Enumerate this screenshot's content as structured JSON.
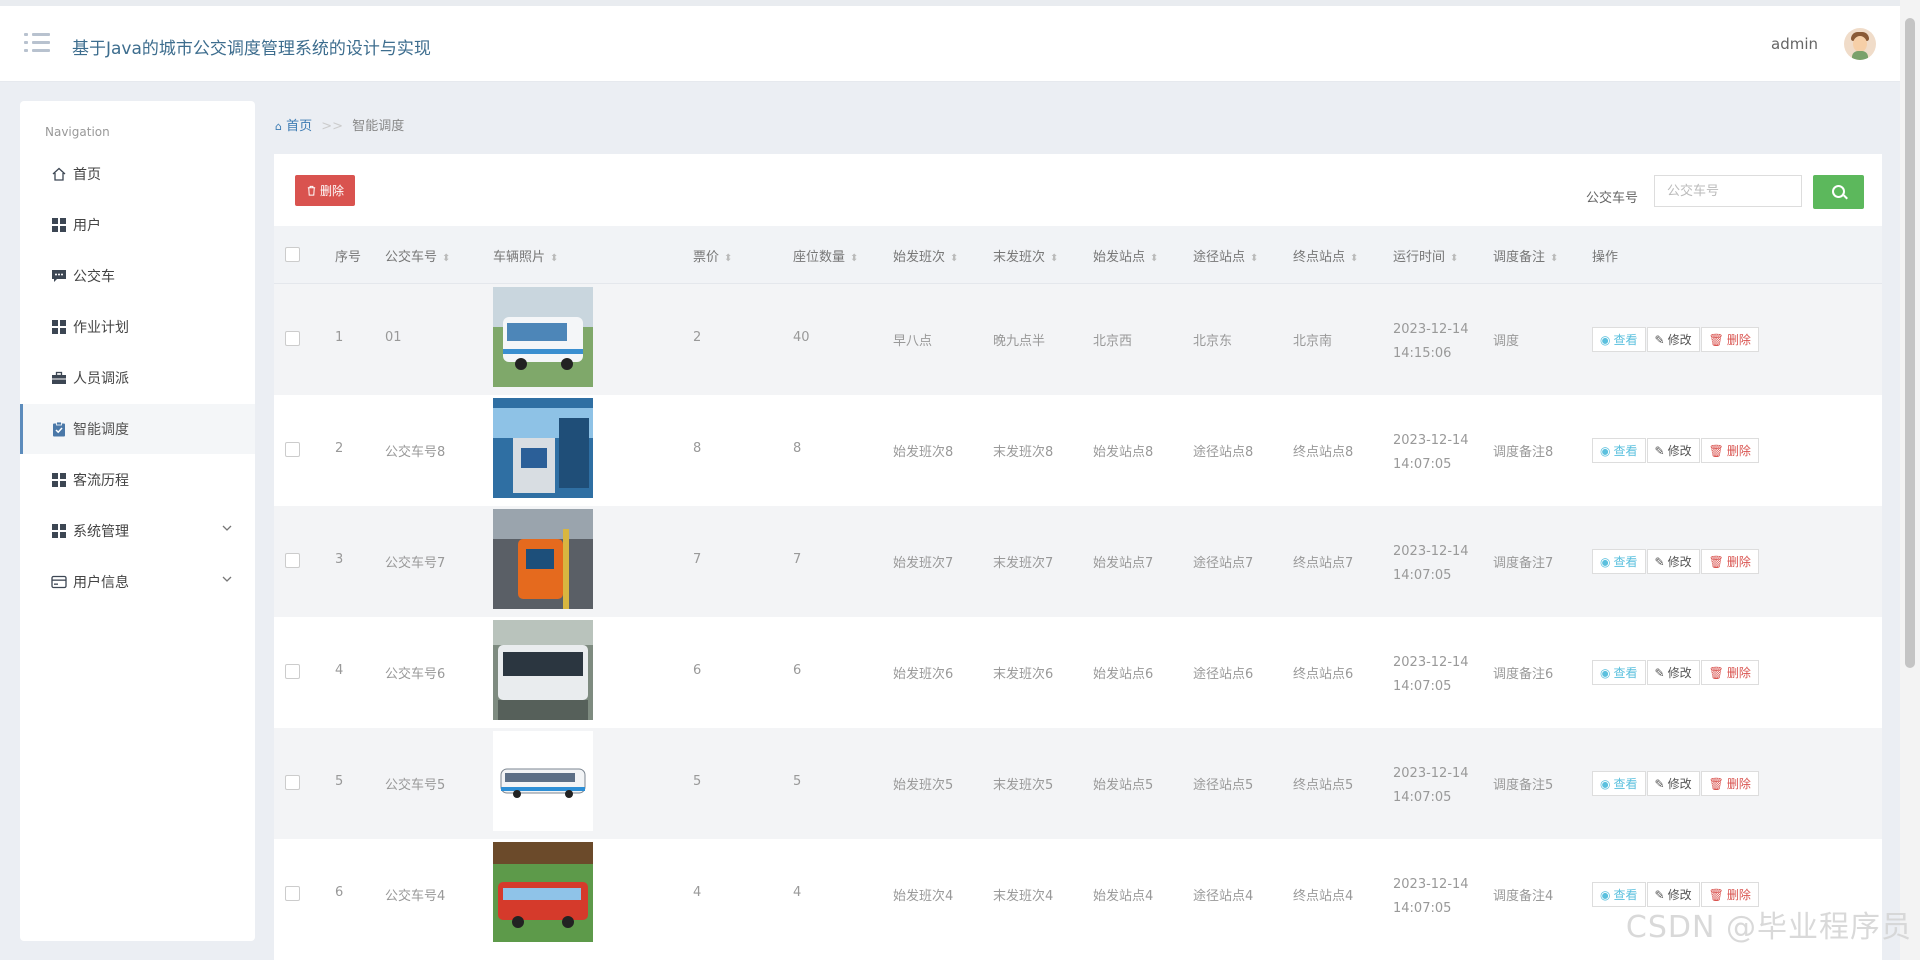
{
  "header": {
    "title": "基于Java的城市公交调度管理系统的设计与实现",
    "user": "admin"
  },
  "sidebar": {
    "title": "Navigation",
    "items": [
      {
        "label": "首页",
        "icon": "home-icon"
      },
      {
        "label": "用户",
        "icon": "grid-icon"
      },
      {
        "label": "公交车",
        "icon": "comment-icon"
      },
      {
        "label": "作业计划",
        "icon": "grid-icon"
      },
      {
        "label": "人员调派",
        "icon": "briefcase-icon"
      },
      {
        "label": "智能调度",
        "icon": "clipboard-check-icon"
      },
      {
        "label": "客流历程",
        "icon": "grid-icon"
      },
      {
        "label": "系统管理",
        "icon": "grid-icon"
      },
      {
        "label": "用户信息",
        "icon": "card-icon"
      }
    ]
  },
  "breadcrumb": {
    "home": "首页",
    "separator": ">>",
    "current": "智能调度"
  },
  "toolbar": {
    "delete_label": "删除",
    "search_label": "公交车号",
    "search_placeholder": "公交车号"
  },
  "table": {
    "columns": [
      "序号",
      "公交车号",
      "车辆照片",
      "票价",
      "座位数量",
      "始发班次",
      "末发班次",
      "始发站点",
      "途径站点",
      "终点站点",
      "运行时间",
      "调度备注",
      "操作"
    ],
    "action_labels": {
      "view": "查看",
      "edit": "修改",
      "delete": "删除"
    },
    "rows": [
      {
        "index": "1",
        "bus_no": "01",
        "price": "2",
        "seats": "40",
        "first": "早八点",
        "last": "晚九点半",
        "start": "北京西",
        "via": "北京东",
        "end": "北京南",
        "date": "2023-12-14",
        "time": "14:15:06",
        "note": "调度"
      },
      {
        "index": "2",
        "bus_no": "公交车号8",
        "price": "8",
        "seats": "8",
        "first": "始发班次8",
        "last": "末发班次8",
        "start": "始发站点8",
        "via": "途径站点8",
        "end": "终点站点8",
        "date": "2023-12-14",
        "time": "14:07:05",
        "note": "调度备注8"
      },
      {
        "index": "3",
        "bus_no": "公交车号7",
        "price": "7",
        "seats": "7",
        "first": "始发班次7",
        "last": "末发班次7",
        "start": "始发站点7",
        "via": "途径站点7",
        "end": "终点站点7",
        "date": "2023-12-14",
        "time": "14:07:05",
        "note": "调度备注7"
      },
      {
        "index": "4",
        "bus_no": "公交车号6",
        "price": "6",
        "seats": "6",
        "first": "始发班次6",
        "last": "末发班次6",
        "start": "始发站点6",
        "via": "途径站点6",
        "end": "终点站点6",
        "date": "2023-12-14",
        "time": "14:07:05",
        "note": "调度备注6"
      },
      {
        "index": "5",
        "bus_no": "公交车号5",
        "price": "5",
        "seats": "5",
        "first": "始发班次5",
        "last": "末发班次5",
        "start": "始发站点5",
        "via": "途径站点5",
        "end": "终点站点5",
        "date": "2023-12-14",
        "time": "14:07:05",
        "note": "调度备注5"
      },
      {
        "index": "6",
        "bus_no": "公交车号4",
        "price": "4",
        "seats": "4",
        "first": "始发班次4",
        "last": "末发班次4",
        "start": "始发站点4",
        "via": "途径站点4",
        "end": "终点站点4",
        "date": "2023-12-14",
        "time": "14:07:05",
        "note": "调度备注4"
      }
    ]
  },
  "watermark": "CSDN @毕业程序员"
}
